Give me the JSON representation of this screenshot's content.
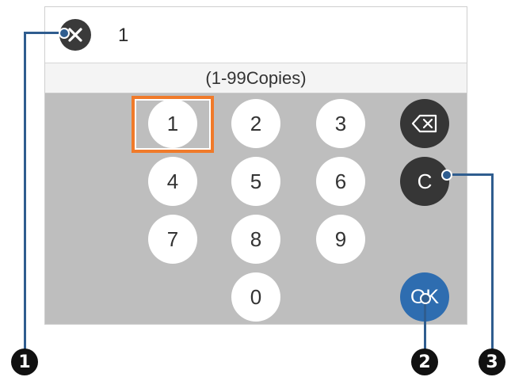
{
  "header": {
    "close_icon": "close-icon",
    "entry_value": "1"
  },
  "range_label": "(1-99Copies)",
  "keypad": {
    "digits": [
      "1",
      "2",
      "3",
      "4",
      "5",
      "6",
      "7",
      "8",
      "9",
      "0"
    ],
    "clear_label": "C",
    "ok_label": "OK",
    "backspace_icon": "backspace-icon",
    "focused_key": "1"
  },
  "callouts": [
    "1",
    "2",
    "3"
  ],
  "colors": {
    "focus": "#f07a2a",
    "ok": "#2e6db0",
    "dark_key": "#363636",
    "keypad_bg": "#bebebe",
    "callout": "#2f5d8f"
  }
}
